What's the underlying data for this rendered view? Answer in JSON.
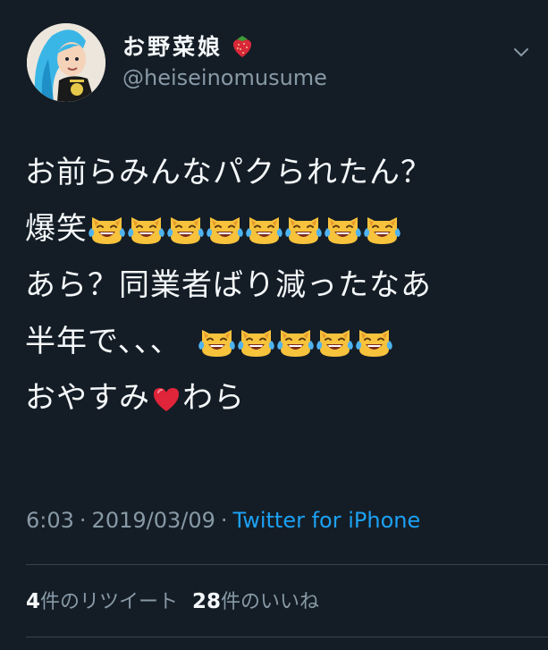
{
  "user": {
    "display_name": "お野菜娘",
    "handle": "@heiseinomusume"
  },
  "tweet": {
    "line1": "お前らみんなパクられたん？",
    "line2_text": "爆笑",
    "line2_emoji_count": 8,
    "line3": "あら？同業者ばり減ったなあ",
    "line4_text": "半年で、、、",
    "line4_emoji_count": 5,
    "line5_before": "おやすみ",
    "line5_after": "わら",
    "emoji_name": "cat-face-with-tears-of-joy-icon"
  },
  "meta": {
    "time": "6:03",
    "separator": "·",
    "date": "2019/03/09",
    "source": "Twitter for iPhone"
  },
  "stats": {
    "retweets_count": "4",
    "retweets_label": "件のリツイート",
    "likes_count": "28",
    "likes_label": "件のいいね"
  },
  "colors": {
    "background": "#141d26",
    "link": "#1da1f2",
    "muted": "#8899a6"
  }
}
